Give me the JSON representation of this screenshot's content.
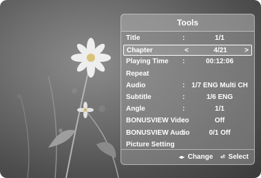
{
  "panel": {
    "title": "Tools",
    "rows": [
      {
        "label": "Title",
        "value": "1/1"
      },
      {
        "label": "Chapter",
        "value": "4/21"
      },
      {
        "label": "Playing Time",
        "value": "00:12:06"
      },
      {
        "label": "Repeat",
        "value": ""
      },
      {
        "label": "Audio",
        "value": "1/7 ENG Multi CH"
      },
      {
        "label": "Subtitle",
        "value": "1/6 ENG"
      },
      {
        "label": "Angle",
        "value": "1/1"
      },
      {
        "label": "BONUSVIEW Video",
        "value": "Off"
      },
      {
        "label": "BONUSVIEW Audio",
        "value": "0/1 Off"
      },
      {
        "label": "Picture Setting",
        "value": ""
      }
    ],
    "colon": ":",
    "selected_arrows": {
      "left": "<",
      "right": ">"
    },
    "footer": {
      "change_icon": "◂▸",
      "change_label": "Change",
      "select_icon": "⏎",
      "select_label": "Select"
    }
  },
  "colors": {
    "panel_bg": "#969696",
    "text": "#ffffff",
    "flower": "#eeeeee"
  }
}
